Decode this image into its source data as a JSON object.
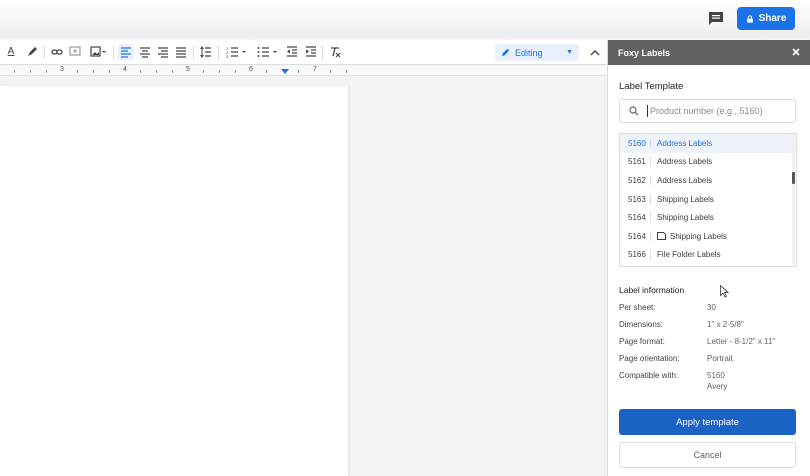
{
  "header": {
    "share_label": "Share",
    "accent": "#1a73e8"
  },
  "toolbar": {
    "mode_label": "Editing",
    "text_color_glyph": "A"
  },
  "ruler": {
    "numbers": [
      "3",
      "4",
      "5",
      "6",
      "7"
    ]
  },
  "panel": {
    "title": "Foxy Labels",
    "section_title": "Label Template",
    "search_placeholder": "Product number (e.g., 5160)",
    "templates": [
      {
        "code": "5160",
        "name": "Address Labels",
        "selected": true,
        "icon": ""
      },
      {
        "code": "5161",
        "name": "Address Labels",
        "selected": false,
        "icon": ""
      },
      {
        "code": "5162",
        "name": "Address Labels",
        "selected": false,
        "icon": ""
      },
      {
        "code": "5163",
        "name": "Shipping Labels",
        "selected": false,
        "icon": ""
      },
      {
        "code": "5164",
        "name": "Shipping Labels",
        "selected": false,
        "icon": ""
      },
      {
        "code": "5164",
        "name": "Shipping Labels",
        "selected": false,
        "icon": "doc-icon"
      },
      {
        "code": "5166",
        "name": "File Folder Labels",
        "selected": false,
        "icon": ""
      }
    ],
    "info_title": "Label information",
    "info": {
      "per_sheet_label": "Per sheet:",
      "per_sheet": "30",
      "dimensions_label": "Dimensions:",
      "dimensions": "1\" x 2-5/8\"",
      "page_format_label": "Page format:",
      "page_format": "Letter - 8-1/2\" x 11\"",
      "orientation_label": "Page orientation:",
      "orientation": "Portrait",
      "compatible_label": "Compatible with:",
      "compatible_code": "5160",
      "compatible_brand": "Avery"
    },
    "apply_label": "Apply template",
    "cancel_label": "Cancel"
  }
}
